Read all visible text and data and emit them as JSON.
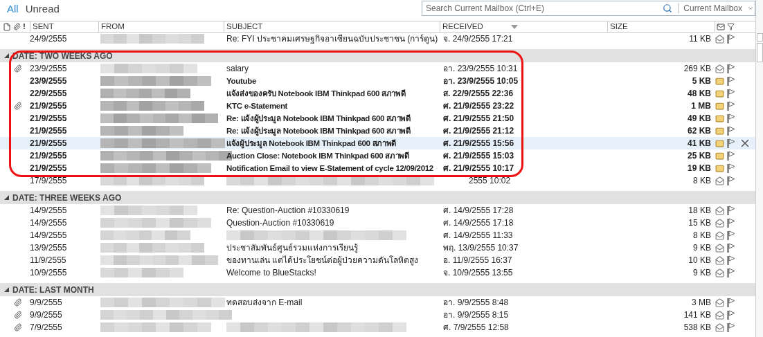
{
  "tabs": [
    {
      "label": "All",
      "selected": true
    },
    {
      "label": "Unread",
      "selected": false
    }
  ],
  "search": {
    "placeholder": "Search Current Mailbox (Ctrl+E)",
    "scope": "Current Mailbox"
  },
  "columns": [
    {
      "kind": "icons",
      "label": "!"
    },
    {
      "kind": "sent",
      "label": "SENT",
      "sorted": false
    },
    {
      "kind": "from",
      "label": "FROM",
      "sorted": false
    },
    {
      "kind": "subject",
      "label": "SUBJECT",
      "sorted": false
    },
    {
      "kind": "received",
      "label": "RECEIVED",
      "sorted": true
    },
    {
      "kind": "size",
      "label": "SIZE",
      "sorted": false
    }
  ],
  "groups": [
    {
      "rows": [
        {
          "sent": "24/9/2555",
          "subject": "Re: FYI ประชาคมเศรษฐกิจอาเซียนฉบับประชาชน (การ์ตูน)",
          "received": "จ. 24/9/2555 17:21",
          "size": "11 KB",
          "unread": false,
          "attachment": false,
          "selected": false
        }
      ]
    },
    {
      "header": "DATE: TWO WEEKS AGO",
      "rows": [
        {
          "sent": "23/9/2555",
          "subject": "salary",
          "received": "อา. 23/9/2555 10:31",
          "size": "269 KB",
          "unread": false,
          "attachment": true,
          "selected": false
        },
        {
          "sent": "23/9/2555",
          "subject": "Youtube",
          "received": "อา. 23/9/2555 10:05",
          "size": "5 KB",
          "unread": true,
          "attachment": false,
          "selected": false
        },
        {
          "sent": "22/9/2555",
          "subject": "แจ้งส่งของครับ Notebook IBM Thinkpad 600 สภาพดี",
          "received": "ส. 22/9/2555 22:36",
          "size": "48 KB",
          "unread": true,
          "attachment": false,
          "selected": false
        },
        {
          "sent": "21/9/2555",
          "subject": "KTC e-Statement",
          "received": "ศ. 21/9/2555 23:22",
          "size": "1 MB",
          "unread": true,
          "attachment": true,
          "selected": false
        },
        {
          "sent": "21/9/2555",
          "subject": "Re: แจ้งผู้ประมูล Notebook IBM Thinkpad 600 สภาพดี",
          "received": "ศ. 21/9/2555 21:50",
          "size": "49 KB",
          "unread": true,
          "attachment": false,
          "selected": false
        },
        {
          "sent": "21/9/2555",
          "subject": "Re: แจ้งผู้ประมูล Notebook IBM Thinkpad 600 สภาพดี",
          "received": "ศ. 21/9/2555 21:12",
          "size": "62 KB",
          "unread": true,
          "attachment": false,
          "selected": false
        },
        {
          "sent": "21/9/2555",
          "subject": "แจ้งผู้ประมูล Notebook IBM Thinkpad 600 สภาพดี",
          "received": "ศ. 21/9/2555 15:56",
          "size": "41 KB",
          "unread": true,
          "attachment": false,
          "selected": true
        },
        {
          "sent": "21/9/2555",
          "subject": "Auction Close: Notebook IBM Thinkpad 600 สภาพดี",
          "received": "ศ. 21/9/2555 15:03",
          "size": "25 KB",
          "unread": true,
          "attachment": false,
          "selected": false
        },
        {
          "sent": "21/9/2555",
          "subject": "Notification Email to view E-Statement of cycle 12/09/2012",
          "received": "ศ. 21/9/2555 10:17",
          "size": "19 KB",
          "unread": true,
          "attachment": false,
          "selected": false
        },
        {
          "sent": "17/9/2555",
          "subject_redacted": true,
          "received": "2555 10:02",
          "size": "8 KB",
          "unread": false,
          "attachment": false,
          "selected": false
        }
      ]
    },
    {
      "header": "DATE: THREE WEEKS AGO",
      "rows": [
        {
          "sent": "14/9/2555",
          "subject": "Re: Question-Auction #10330619",
          "received": "ศ. 14/9/2555 17:28",
          "size": "18 KB",
          "unread": false,
          "attachment": false,
          "selected": false
        },
        {
          "sent": "14/9/2555",
          "subject": "Question-Auction #10330619",
          "received": "ศ. 14/9/2555 17:18",
          "size": "15 KB",
          "unread": false,
          "attachment": false,
          "selected": false
        },
        {
          "sent": "14/9/2555",
          "subject_redacted": true,
          "received": "ศ. 14/9/2555 11:33",
          "size": "8 KB",
          "unread": false,
          "attachment": false,
          "selected": false
        },
        {
          "sent": "13/9/2555",
          "subject": "ประชาสัมพันธ์ศูนย์รวมแห่งการเรียนรู้",
          "received": "พฤ. 13/9/2555 10:37",
          "size": "9 KB",
          "unread": false,
          "attachment": false,
          "selected": false
        },
        {
          "sent": "11/9/2555",
          "subject": "ของทานเล่น แต่ได้ประโยชน์ต่อผู้ป่วยความดันโลหิตสูง",
          "received": "อ. 11/9/2555 16:37",
          "size": "10 KB",
          "unread": false,
          "attachment": false,
          "selected": false
        },
        {
          "sent": "10/9/2555",
          "subject": "Welcome to BlueStacks!",
          "received": "จ. 10/9/2555 13:55",
          "size": "9 KB",
          "unread": false,
          "attachment": false,
          "selected": false
        }
      ]
    },
    {
      "header": "DATE: LAST MONTH",
      "rows": [
        {
          "sent": "9/9/2555",
          "subject": "ทดสอบส่งจาก E-mail",
          "received": "อา. 9/9/2555 8:48",
          "size": "3 MB",
          "unread": false,
          "attachment": true,
          "selected": false
        },
        {
          "sent": "9/9/2555",
          "received": "อา. 9/9/2555 8:15",
          "size": "141 KB",
          "unread": false,
          "attachment": true,
          "selected": false,
          "subject_redacted": false
        },
        {
          "sent": "7/9/2555",
          "subject_redacted": true,
          "received": "ศ. 7/9/2555 12:58",
          "size": "538 KB",
          "unread": false,
          "attachment": true,
          "selected": false
        }
      ]
    }
  ]
}
